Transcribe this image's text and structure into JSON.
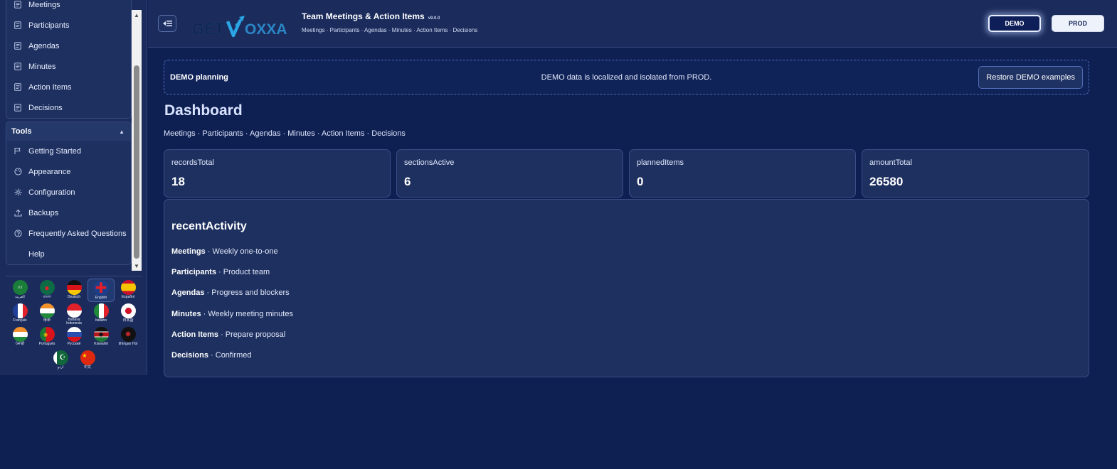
{
  "sidebar": {
    "section_items": [
      {
        "label": "Meetings",
        "icon": "document-icon"
      },
      {
        "label": "Participants",
        "icon": "document-icon"
      },
      {
        "label": "Agendas",
        "icon": "document-icon"
      },
      {
        "label": "Minutes",
        "icon": "document-icon"
      },
      {
        "label": "Action Items",
        "icon": "document-icon"
      },
      {
        "label": "Decisions",
        "icon": "document-icon"
      }
    ],
    "tools": {
      "header": "Tools",
      "items": [
        {
          "label": "Getting Started",
          "icon": "flag-icon"
        },
        {
          "label": "Appearance",
          "icon": "palette-icon"
        },
        {
          "label": "Configuration",
          "icon": "gear-icon"
        },
        {
          "label": "Backups",
          "icon": "upload-icon"
        },
        {
          "label": "Frequently Asked Questions",
          "icon": "help-circle-icon"
        },
        {
          "label": "Help",
          "icon": "blank-icon"
        }
      ]
    },
    "languages": [
      {
        "label": "العربية",
        "flag": "saudi"
      },
      {
        "label": "বাংলা",
        "flag": "bangladesh"
      },
      {
        "label": "Deutsch",
        "flag": "germany"
      },
      {
        "label": "English",
        "flag": "uk"
      },
      {
        "label": "Español",
        "flag": "spain"
      },
      {
        "label": "Français",
        "flag": "france"
      },
      {
        "label": "हिन्दी",
        "flag": "india"
      },
      {
        "label": "Bahasa Indonesia",
        "flag": "indonesia"
      },
      {
        "label": "Italiano",
        "flag": "italy"
      },
      {
        "label": "日本語",
        "flag": "japan"
      },
      {
        "label": "ਪੰਜਾਬੀ",
        "flag": "india"
      },
      {
        "label": "Português",
        "flag": "portugal"
      },
      {
        "label": "Русский",
        "flag": "russia"
      },
      {
        "label": "Kiswahili",
        "flag": "kenya"
      },
      {
        "label": "tlhIngan Hol",
        "flag": "klingon"
      },
      {
        "label": "اردو",
        "flag": "pakistan"
      },
      {
        "label": "中文",
        "flag": "china"
      }
    ],
    "active_language": "English"
  },
  "header": {
    "logo_text_a": "GET",
    "logo_text_b": "OXXA",
    "title": "Team Meetings & Action Items",
    "version": "v9.0.0",
    "subtitle": "Meetings · Participants · Agendas · Minutes · Action Items · Decisions",
    "env_demo": "DEMO",
    "env_prod": "PROD"
  },
  "banner": {
    "title": "DEMO planning",
    "message": "DEMO data is localized and isolated from PROD.",
    "restore_label": "Restore DEMO examples"
  },
  "main": {
    "page_title": "Dashboard",
    "breadcrumb": "Meetings · Participants · Agendas · Minutes · Action Items · Decisions",
    "stats": [
      {
        "label": "recordsTotal",
        "value": "18"
      },
      {
        "label": "sectionsActive",
        "value": "6"
      },
      {
        "label": "plannedItems",
        "value": "0"
      },
      {
        "label": "amountTotal",
        "value": "26580"
      }
    ],
    "activity": {
      "title": "recentActivity",
      "rows": [
        {
          "section": "Meetings",
          "detail": " · Weekly one-to-one"
        },
        {
          "section": "Participants",
          "detail": " · Product team"
        },
        {
          "section": "Agendas",
          "detail": " · Progress and blockers"
        },
        {
          "section": "Minutes",
          "detail": " · Weekly meeting minutes"
        },
        {
          "section": "Action Items",
          "detail": " · Prepare proposal"
        },
        {
          "section": "Decisions",
          "detail": " · Confirmed"
        }
      ]
    }
  },
  "colors": {
    "page_bg": "#0e1f52",
    "panel_bg": "#1b2c5c",
    "card_bg": "#1e305f",
    "accent_border": "#4d6cb8"
  }
}
